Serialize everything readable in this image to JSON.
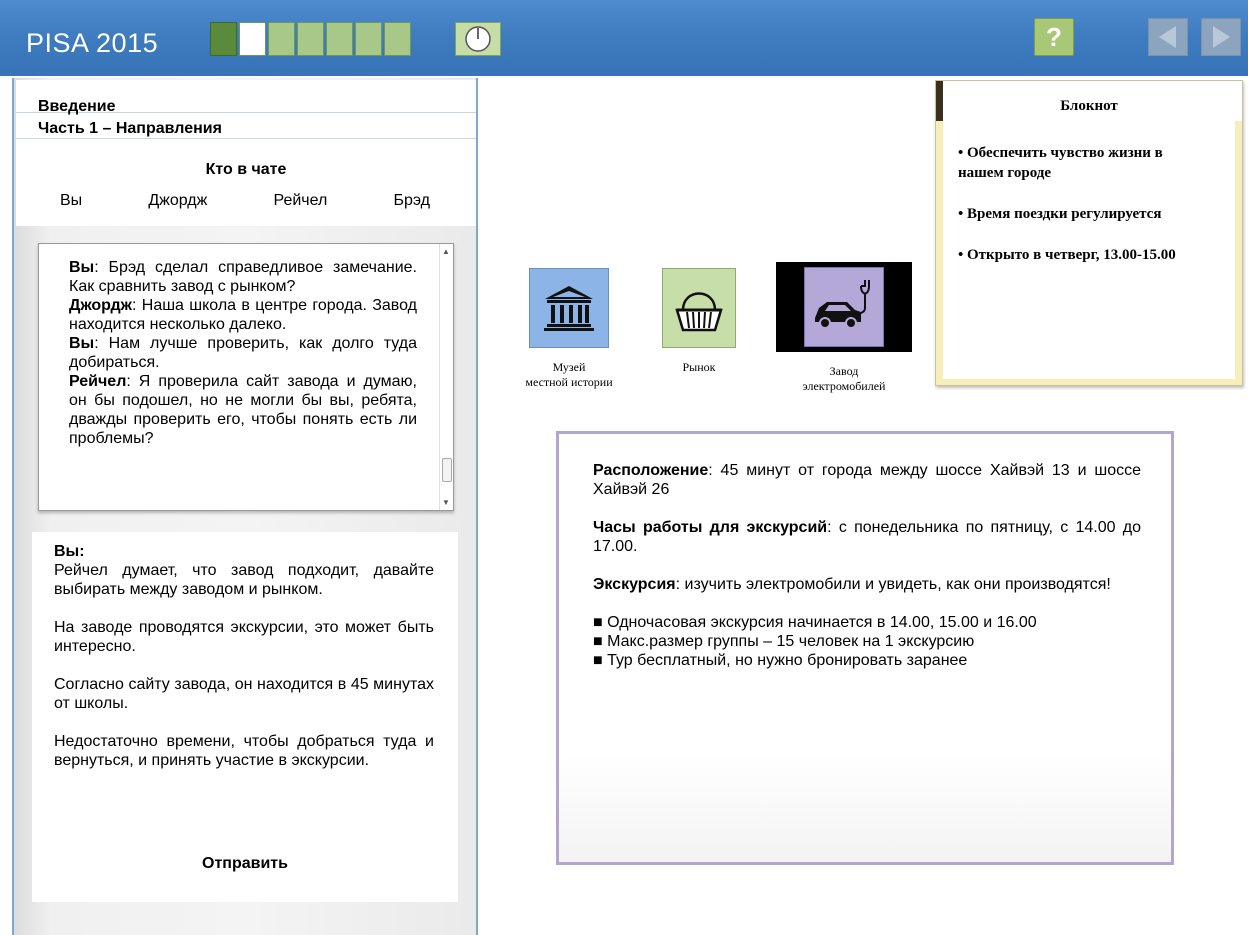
{
  "header": {
    "title": "PISA 2015",
    "progress": {
      "total": 7,
      "completed": 1,
      "current": 2
    },
    "help_label": "?"
  },
  "intro": {
    "line1": "Введение",
    "line2": "Часть 1 – Направления"
  },
  "chat_members": {
    "title": "Кто в чате",
    "names": [
      "Вы",
      "Джордж",
      "Рейчел",
      "Брэд"
    ]
  },
  "chat_log": [
    {
      "speaker": "Вы",
      "text": ": Брэд сделал справедливое замечание. Как сравнить завод с рынком?"
    },
    {
      "speaker": "Джордж",
      "text": ": Наша школа в центре города. Завод находится несколько далеко."
    },
    {
      "speaker": "Вы",
      "text": ": Нам лучше проверить, как долго туда добираться."
    },
    {
      "speaker": "Рейчел",
      "text": ": Я проверила сайт завода и думаю, он бы подошел, но не могли бы вы, ребята, дважды проверить его, чтобы понять есть ли проблемы?"
    }
  ],
  "answer": {
    "who": "Вы:",
    "options": [
      "Рейчел думает, что завод подходит, давайте выбирать между заводом и рынком.",
      "На заводе проводятся экскурсии, это может быть интересно.",
      "Согласно сайту завода, он находится в 45 минутах от школы.",
      "Недостаточно времени, чтобы добраться туда и вернуться, и принять участие в экскурсии."
    ],
    "send_label": "Отправить"
  },
  "notepad": {
    "title": "Блокнот",
    "items": [
      "• Обеспечить чувство жизни в нашем городе",
      "• Время поездки регулируется",
      "• Открыто в четверг, 13.00-15.00"
    ]
  },
  "places": [
    {
      "name": "Музей местной истории",
      "line1": "Музей",
      "line2": "местной истории",
      "icon": "museum-icon"
    },
    {
      "name": "Рынок",
      "line1": "Рынок",
      "line2": "",
      "icon": "basket-icon"
    },
    {
      "name": "Завод электромобилей",
      "line1": "Завод",
      "line2": "электромобилей",
      "icon": "electric-car-icon"
    }
  ],
  "info": {
    "location_label": "Расположение",
    "location_text": ": 45 минут от города между шоссе Хайвэй 13 и шоссе Хайвэй 26",
    "hours_label": "Часы работы для экскурсий",
    "hours_text": ": с понедельника по пятницу, с 14.00 до 17.00.",
    "tour_label": "Экскурсия",
    "tour_text": ": изучить электромобили и увидеть, как они производятся!",
    "bullets": [
      "■ Одночасовая экскурсия начинается в 14.00, 15.00 и 16.00",
      "■ Макс.размер группы – 15 человек на 1 экскурсию",
      "■ Тур бесплатный, но нужно бронировать заранее"
    ]
  },
  "colors": {
    "topbar": "#3f7cc0",
    "progress_done": "#5a8a3a",
    "progress_todo": "#a7c888",
    "museum_tile": "#8cb4e6",
    "market_tile": "#c8dea8",
    "factory_tile": "#b4a8d8",
    "infobox_border": "#b3a6cc",
    "notepad_margin": "#f6efbc"
  }
}
